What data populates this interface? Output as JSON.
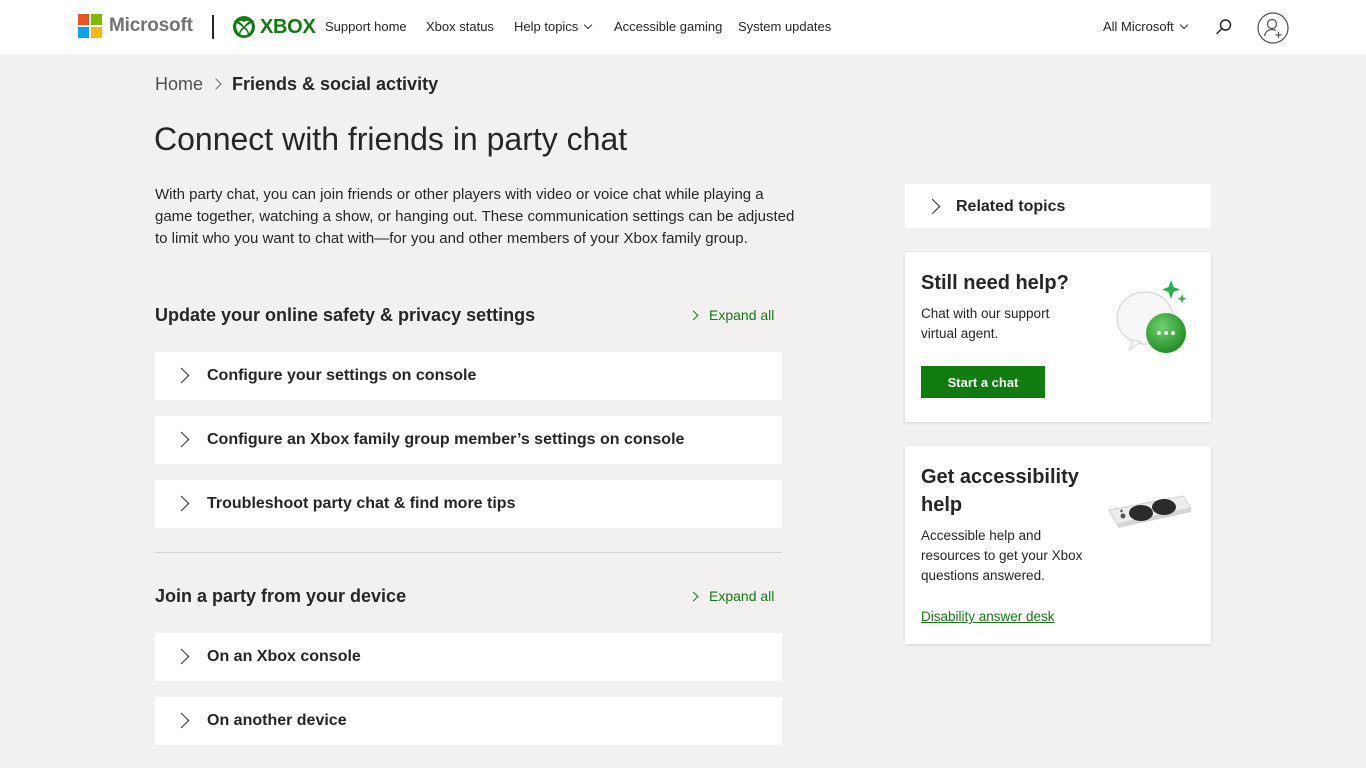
{
  "header": {
    "brand": "Microsoft",
    "xbox": "XBOX",
    "nav": [
      "Support home",
      "Xbox status",
      "Help topics",
      "Accessible gaming",
      "System updates"
    ],
    "all_microsoft": "All Microsoft",
    "colors": {
      "ms_red": "#f25022",
      "ms_green": "#7fba00",
      "ms_blue": "#00a4ef",
      "ms_yellow": "#ffb900",
      "xbox_green": "#107c10"
    }
  },
  "breadcrumb": {
    "home": "Home",
    "current": "Friends & social activity"
  },
  "title": "Connect with friends in party chat",
  "intro": "With party chat, you can join friends or other players with video or voice chat while playing a game together, watching a show, or hanging out. These communication settings can be adjusted to limit who you want to chat with—for you and other members of your Xbox family group.",
  "sections": [
    {
      "heading": "Update your online safety & privacy settings",
      "expand_all": "Expand all",
      "items": [
        "Configure your settings on console",
        "Configure an Xbox family group member’s settings on console",
        "Troubleshoot party chat & find more tips"
      ]
    },
    {
      "heading": "Join a party from your device",
      "expand_all": "Expand all",
      "items": [
        "On an Xbox console",
        "On another device"
      ]
    }
  ],
  "sidebar": {
    "related": "Related topics",
    "help_card": {
      "title": "Still need help?",
      "text_line1": "Chat with our support",
      "text_line2": "virtual agent.",
      "button": "Start a chat"
    },
    "access_card": {
      "title_line1": "Get accessibility",
      "title_line2": "help",
      "text_line1": "Accessible help and",
      "text_line2": "resources to get your Xbox",
      "text_line3": "questions answered.",
      "link": "Disability answer desk"
    }
  }
}
